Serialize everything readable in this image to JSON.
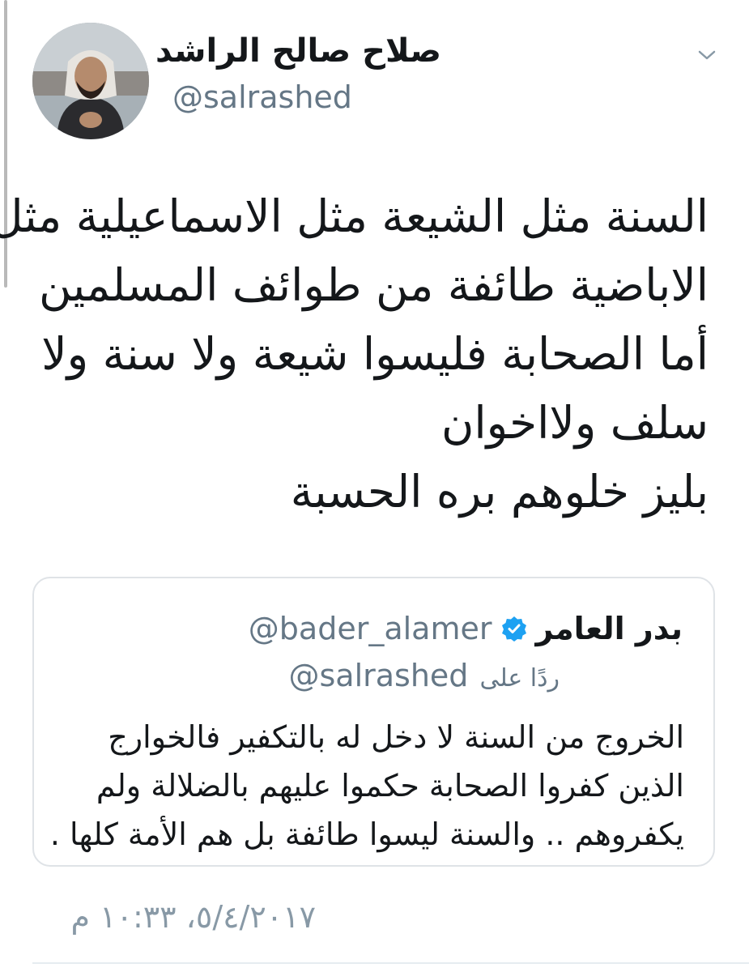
{
  "tweet": {
    "author_name": "صلاح صالح الراشد",
    "author_handle": "@salrashed",
    "text_lines": [
      "السنة مثل الشيعة مثل الاسماعيلية مثل",
      "الاباضية طائفة من طوائف المسلمين",
      "أما الصحابة فليسوا شيعة ولا سنة ولا",
      "سلف ولااخوان",
      "بليز خلوهم بره الحسبة"
    ],
    "timestamp": "٥/٤/٢٠١٧، ١٠:٣٣ م"
  },
  "quoted_tweet": {
    "author_name": "بدر العامر",
    "author_handle": "@bader_alamer",
    "verified": true,
    "reply_label": "ردًا على",
    "reply_handle": "@salrashed",
    "text_lines": [
      "الخروج من السنة لا دخل له بالتكفير فالخوارج",
      "الذين كفروا الصحابة حكموا عليهم بالضلالة ولم",
      "يكفروهم .. والسنة ليسوا طائفة بل هم الأمة كلها ."
    ]
  },
  "icons": {
    "chevron": "chevron-down-icon",
    "verified": "verified-badge-icon"
  },
  "colors": {
    "text_primary": "#14171a",
    "text_secondary": "#657786",
    "verified_blue": "#1da1f2",
    "card_border": "#dfe3e7"
  }
}
